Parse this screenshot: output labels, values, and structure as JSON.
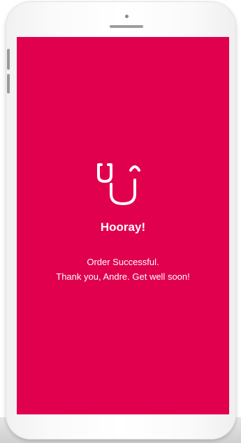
{
  "screen": {
    "background_color": "#e0004d",
    "logo_icon": "stethoscope-smile-icon",
    "title": "Hooray!",
    "message_line1": "Order Successful.",
    "message_line2": "Thank you, Andre. Get well soon!"
  }
}
